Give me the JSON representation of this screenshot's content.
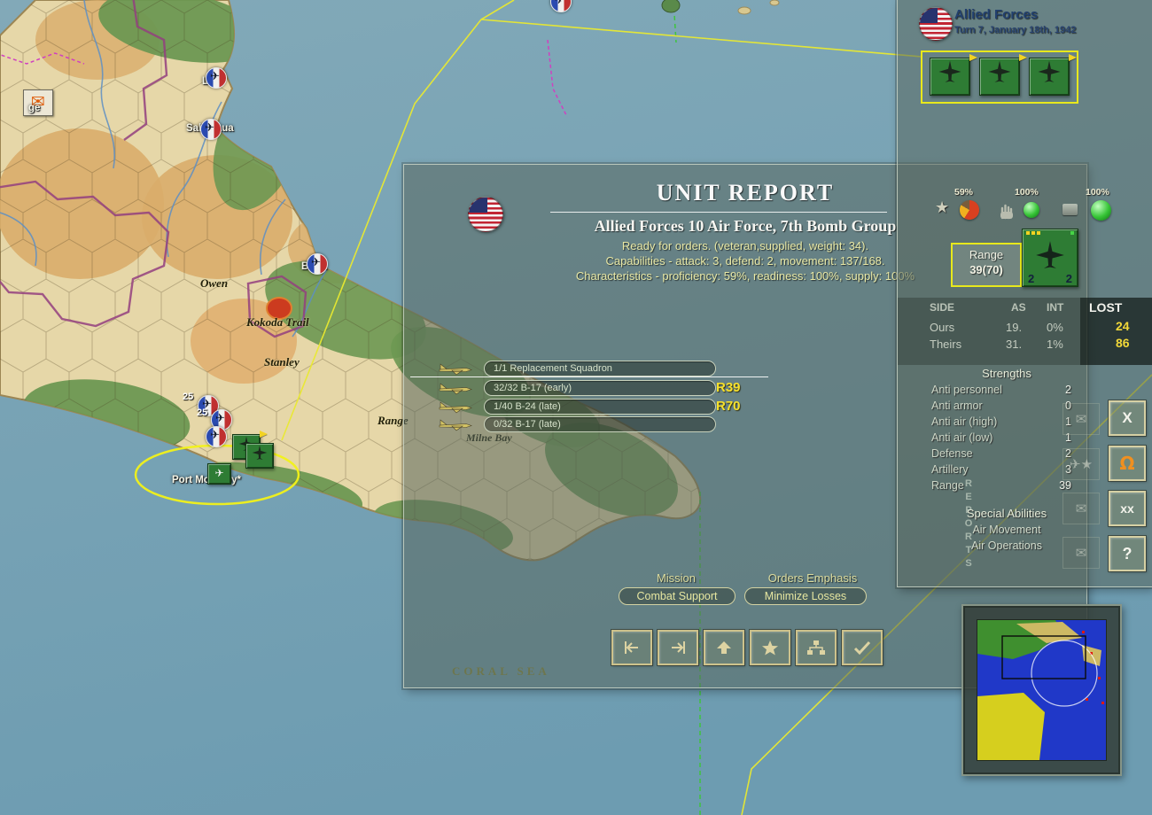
{
  "icons": {
    "envelope": "✉",
    "star": "★",
    "plane": "✈",
    "cross": "X",
    "omega": "Ω",
    "divide": "xx",
    "question": "?"
  },
  "map": {
    "labels": {
      "fragment": "ge",
      "lae": "Lae*",
      "salamaua": "Salamaua",
      "buna": "Buna",
      "owen": "Owen",
      "kokoda_trail": "Kokoda Trail",
      "stanley": "Stanley",
      "range": "Range",
      "milne_bay": "Milne Bay",
      "port_moresby": "Port Moresby*",
      "coral_sea": "CORAL SEA"
    },
    "unit_badges": [
      "25",
      "25"
    ]
  },
  "unit_report": {
    "title": "UNIT REPORT",
    "unit_name": "Allied Forces 10 Air Force, 7th Bomb Group",
    "status_line": "Ready for orders. (veteran,supplied, weight: 34).",
    "capabilities_line": "Capabilities - attack: 3, defend: 2, movement: 137/168.",
    "characteristics_line": "Characteristics - proficiency: 59%, readiness: 100%, supply: 100%",
    "squadrons": [
      {
        "name": "1/1 Replacement Squadron",
        "range": ""
      },
      {
        "name": "32/32 B-17 (early)",
        "range": "R39"
      },
      {
        "name": "1/40 B-24 (late)",
        "range": "R70"
      },
      {
        "name": "0/32 B-17 (late)",
        "range": ""
      }
    ],
    "mission": {
      "label": "Mission",
      "value": "Combat Support"
    },
    "orders_emphasis": {
      "label": "Orders Emphasis",
      "value": "Minimize Losses"
    }
  },
  "side_panel": {
    "faction": "Allied Forces",
    "turn": "Turn 7, January 18th, 1942",
    "stats": {
      "proficiency": "59%",
      "readiness": "100%",
      "supply": "100%"
    },
    "range": {
      "label": "Range",
      "value": "39(70)"
    },
    "counter": {
      "left": "2",
      "right": "2"
    },
    "losses": {
      "col_side": "SIDE",
      "col_as": "AS",
      "col_int": "INT",
      "col_lost": "LOST",
      "rows": [
        {
          "side": "Ours",
          "as": "19.",
          "int": "0%",
          "lost": "24"
        },
        {
          "side": "Theirs",
          "as": "31.",
          "int": "1%",
          "lost": "86"
        }
      ]
    },
    "strengths": {
      "title": "Strengths",
      "items": [
        {
          "label": "Anti personnel",
          "value": "2"
        },
        {
          "label": "Anti armor",
          "value": "0"
        },
        {
          "label": "Anti air (high)",
          "value": "1"
        },
        {
          "label": "Anti air (low)",
          "value": "1"
        },
        {
          "label": "Defense",
          "value": "2"
        },
        {
          "label": "Artillery",
          "value": "3"
        },
        {
          "label": "Range",
          "value": "39"
        }
      ]
    },
    "special_abilities": {
      "title": "Special Abilities",
      "items": [
        "Air Movement",
        "Air Operations"
      ]
    },
    "reports_tab": "REPORTS"
  }
}
